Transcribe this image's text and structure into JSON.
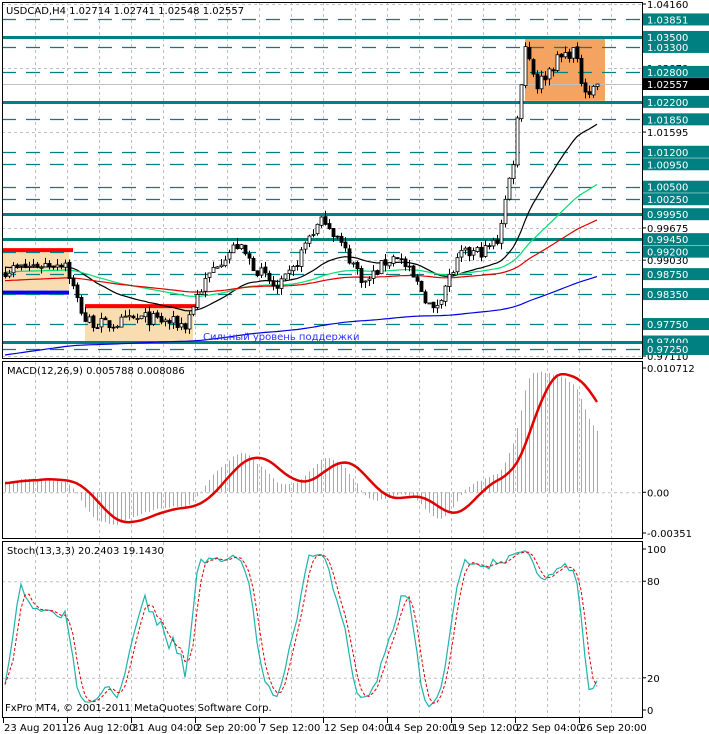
{
  "header": {
    "symbol_line": "USDCAD,H4  1.02714 1.02741 1.02548 1.02557",
    "macd_line": "MACD(12,26,9) 0.005788 0.008086",
    "stoch_line": "Stoch(13,3,3) 20.2403 19.1430",
    "copyright": "FxPro MT4, © 2001-2011 MetaQuotes Software Corp."
  },
  "colors": {
    "level": "#008080",
    "grid": "#c0c0c0",
    "box_light": "#f9dcb0",
    "box_orange": "#f4a460",
    "ma_black": "#000000",
    "ma_green": "#00e070",
    "ma_red": "#e00000",
    "ma_blue": "#0000e0",
    "macd_hist": "#a8a8a8",
    "macd_signal": "#e00000",
    "stoch_main": "#20b2aa",
    "stoch_signal": "#e00000",
    "annotation": "#3030ff"
  },
  "chart_data": {
    "type": "candlestick",
    "symbol": "USDCAD",
    "timeframe": "H4",
    "ylim": [
      0.9711,
      1.0416
    ],
    "last_close": 1.02557,
    "current_price_label": "1.02557",
    "price_ticks": [
      "1.04160",
      "1.02879",
      "1.01595",
      "0.99675",
      "0.99030",
      "0.97110"
    ],
    "price_tick_values": [
      1.0416,
      1.02879,
      1.01595,
      0.99675,
      0.9903,
      0.9711
    ],
    "x_tick_labels": [
      "23 Aug 2011",
      "26 Aug 12:00",
      "31 Aug 04:00",
      "2 Sep 20:00",
      "7 Sep 12:00",
      "12 Sep 04:00",
      "14 Sep 20:00",
      "19 Sep 12:00",
      "22 Sep 04:00",
      "26 Sep 20:00"
    ],
    "x_tick_candle_index": [
      0,
      16,
      32,
      48,
      64,
      80,
      96,
      112,
      128,
      144
    ],
    "candle_count": 149,
    "close_keypoints": [
      [
        0,
        0.9883
      ],
      [
        8,
        0.9893
      ],
      [
        15,
        0.9899
      ],
      [
        16,
        0.9873
      ],
      [
        18,
        0.9823
      ],
      [
        20,
        0.9783
      ],
      [
        25,
        0.9773
      ],
      [
        35,
        0.9787
      ],
      [
        45,
        0.9773
      ],
      [
        48,
        0.9833
      ],
      [
        53,
        0.9899
      ],
      [
        58,
        0.9933
      ],
      [
        62,
        0.9893
      ],
      [
        68,
        0.9843
      ],
      [
        72,
        0.9883
      ],
      [
        76,
        0.9953
      ],
      [
        80,
        0.9987
      ],
      [
        84,
        0.9933
      ],
      [
        90,
        0.9857
      ],
      [
        95,
        0.9899
      ],
      [
        98,
        0.9913
      ],
      [
        104,
        0.9843
      ],
      [
        107,
        0.9799
      ],
      [
        110,
        0.9853
      ],
      [
        114,
        0.9913
      ],
      [
        120,
        0.9923
      ],
      [
        123,
        0.9943
      ],
      [
        125,
        1.0023
      ],
      [
        127,
        1.0104
      ],
      [
        129,
        1.0264
      ],
      [
        130,
        1.0334
      ],
      [
        133,
        1.0254
      ],
      [
        138,
        1.0304
      ],
      [
        142,
        1.0324
      ],
      [
        144,
        1.0264
      ],
      [
        146,
        1.024
      ],
      [
        148,
        1.02557
      ]
    ],
    "levels": [
      {
        "label": "1.03851",
        "price": 1.03851,
        "style": "dashed"
      },
      {
        "label": "1.03500",
        "price": 1.035,
        "style": "solid"
      },
      {
        "label": "1.03300",
        "price": 1.033,
        "style": "dashed"
      },
      {
        "label": "1.02800",
        "price": 1.028,
        "style": "dashed"
      },
      {
        "label": "1.02200",
        "price": 1.022,
        "style": "solid"
      },
      {
        "label": "1.01850",
        "price": 1.0185,
        "style": "dashed"
      },
      {
        "label": "1.01200",
        "price": 1.012,
        "style": "dashed"
      },
      {
        "label": "1.00950",
        "price": 1.0095,
        "style": "dashed"
      },
      {
        "label": "1.00500",
        "price": 1.005,
        "style": "dashed"
      },
      {
        "label": "1.00250",
        "price": 1.0025,
        "style": "dashed"
      },
      {
        "label": "0.99950",
        "price": 0.9995,
        "style": "solid"
      },
      {
        "label": "0.99450",
        "price": 0.9945,
        "style": "solid"
      },
      {
        "label": "0.99200",
        "price": 0.992,
        "style": "dashed"
      },
      {
        "label": "0.98750",
        "price": 0.9875,
        "style": "dashed"
      },
      {
        "label": "0.98350",
        "price": 0.9835,
        "style": "dashed"
      },
      {
        "label": "0.97750",
        "price": 0.9775,
        "style": "dashed"
      },
      {
        "label": "0.97400",
        "price": 0.974,
        "style": "solid"
      },
      {
        "label": "0.97250",
        "price": 0.9725,
        "style": "dashed"
      }
    ],
    "zones": [
      {
        "name": "range-box-1",
        "from_index": -1,
        "to_index": 16,
        "top": 0.9923,
        "bottom": 0.9838,
        "color": "light",
        "top_line": "red",
        "bottom_line": "blue"
      },
      {
        "name": "range-box-2",
        "from_index": 20,
        "to_index": 47,
        "top": 0.9811,
        "bottom": 0.9741,
        "color": "light",
        "top_line": "red"
      },
      {
        "name": "range-box-3",
        "from_index": 130,
        "to_index": 150,
        "top": 1.035,
        "bottom": 1.0222,
        "color": "orange"
      }
    ],
    "annotation": "Сильный уровень поддержки",
    "moving_averages": [
      {
        "name": "ma-black",
        "type": "EMA",
        "period": 34,
        "seed": 0.989,
        "color": "ma_black"
      },
      {
        "name": "ma-green",
        "type": "EMA",
        "period": 80,
        "seed": 0.988,
        "color": "ma_green"
      },
      {
        "name": "ma-red",
        "type": "EMA",
        "period": 145,
        "seed": 0.9862,
        "color": "ma_red"
      },
      {
        "name": "ma-blue",
        "type": "EMA",
        "period": 300,
        "seed": 0.9712,
        "color": "ma_blue"
      }
    ],
    "macd": {
      "fast": 12,
      "slow": 26,
      "signal": 9,
      "ylim": [
        -0.00351,
        0.010712
      ],
      "ticks": [
        "0.010712",
        "0.00",
        "-0.00351"
      ],
      "tick_values": [
        0.010712,
        0,
        -0.00351
      ]
    },
    "stochastic": {
      "k": 13,
      "d": 3,
      "slowing": 3,
      "ylim": [
        0,
        100
      ],
      "ticks": [
        "100",
        "80",
        "20",
        "0"
      ],
      "tick_values": [
        100,
        80,
        20,
        0
      ]
    }
  }
}
